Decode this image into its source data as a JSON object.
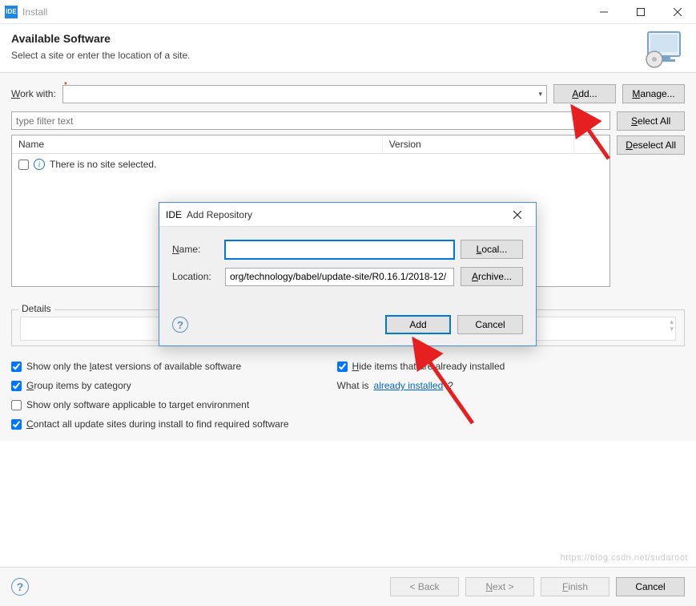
{
  "titlebar": {
    "ide": "IDE",
    "title": "Install"
  },
  "header": {
    "title": "Available Software",
    "subtitle": "Select a site or enter the location of a site."
  },
  "workWith": {
    "label": "Work with:",
    "value": "",
    "add": "Add...",
    "manage": "Manage..."
  },
  "filter": {
    "placeholder": "type filter text"
  },
  "tree": {
    "colName": "Name",
    "colVersion": "Version",
    "emptyText": "There is no site selected."
  },
  "sideButtons": {
    "selectAll": "Select All",
    "deselectAll": "Deselect All"
  },
  "details": {
    "legend": "Details"
  },
  "options": {
    "latest": "Show only the latest versions of available software",
    "group": "Group items by category",
    "applicable": "Show only software applicable to target environment",
    "contact": "Contact all update sites during install to find required software",
    "hide": "Hide items that are already installed",
    "whatIsPrefix": "What is ",
    "whatIsLink": "already installed",
    "whatIsSuffix": "?"
  },
  "footer": {
    "back": "< Back",
    "next": "Next >",
    "finish": "Finish",
    "cancel": "Cancel"
  },
  "dialog": {
    "title": "Add Repository",
    "nameLabel": "Name:",
    "nameValue": "",
    "locationLabel": "Location:",
    "locationValue": "org/technology/babel/update-site/R0.16.1/2018-12/",
    "local": "Local...",
    "archive": "Archive...",
    "add": "Add",
    "cancel": "Cancel"
  },
  "watermark": "https://blog.csdn.net/sudaroot"
}
